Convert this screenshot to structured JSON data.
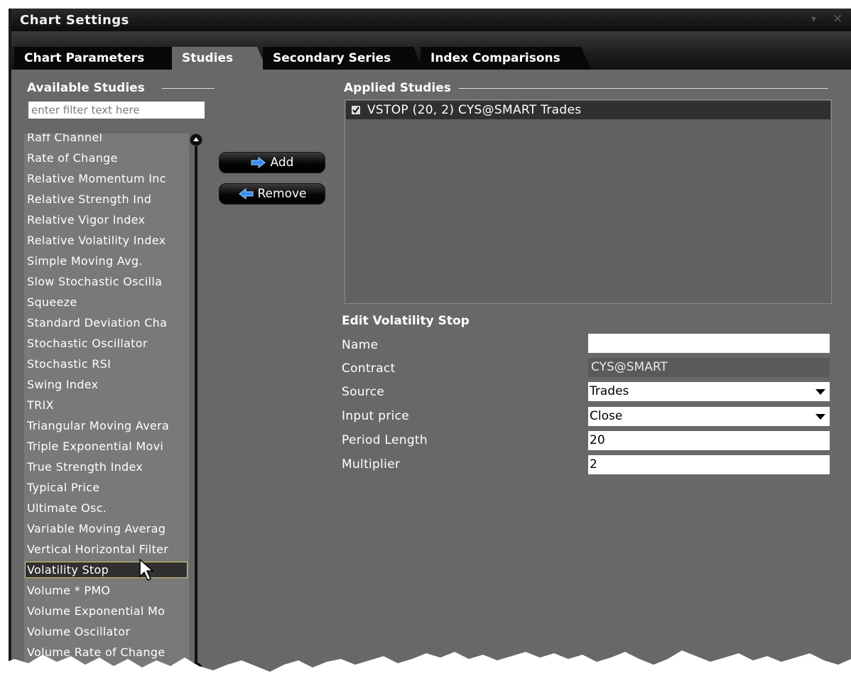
{
  "window": {
    "title": "Chart Settings",
    "controls": {
      "menu_icon": "dropdown-arrow-icon",
      "close_icon": "close-icon"
    }
  },
  "tabs": [
    {
      "label": "Chart Parameters",
      "active": false
    },
    {
      "label": "Studies",
      "active": true
    },
    {
      "label": "Secondary Series",
      "active": false
    },
    {
      "label": "Index Comparisons",
      "active": false
    }
  ],
  "available_studies": {
    "heading": "Available Studies",
    "filter_placeholder": "enter filter text here",
    "items": [
      "Raff Channel",
      "Rate of Change",
      "Relative Momentum Inc",
      "Relative Strength Ind",
      "Relative Vigor Index",
      "Relative Volatility Index",
      "Simple Moving Avg.",
      "Slow Stochastic Oscilla",
      "Squeeze",
      "Standard Deviation Cha",
      "Stochastic Oscillator",
      "Stochastic RSI",
      "Swing Index",
      "TRIX",
      "Triangular Moving Avera",
      "Triple Exponential Movi",
      "True Strength Index",
      "Typical Price",
      "Ultimate Osc.",
      "Variable Moving Averag",
      "Vertical Horizontal Filter",
      "Volatility Stop",
      "Volume * PMO",
      "Volume Exponential Mo",
      "Volume Oscillator",
      "Volume Rate of Change"
    ],
    "selected": "Volatility Stop"
  },
  "buttons": {
    "add_label": "Add",
    "remove_label": "Remove"
  },
  "applied_studies": {
    "heading": "Applied Studies",
    "items": [
      {
        "label": "VSTOP (20, 2) CYS@SMART Trades",
        "checked": true
      }
    ]
  },
  "edit": {
    "title": "Edit Volatility Stop",
    "fields": {
      "name": {
        "label": "Name",
        "value": ""
      },
      "contract": {
        "label": "Contract",
        "value": "CYS@SMART"
      },
      "source": {
        "label": "Source",
        "value": "Trades"
      },
      "input_price": {
        "label": "Input price",
        "value": "Close"
      },
      "period_length": {
        "label": "Period Length",
        "value": "20"
      },
      "multiplier": {
        "label": "Multiplier",
        "value": "2"
      }
    }
  },
  "colors": {
    "panel_bg": "#686868",
    "title_bar": "#121212",
    "selected_row": "#303030",
    "add_arrow": "#3a8cf0",
    "remove_arrow": "#3a8cf0"
  }
}
